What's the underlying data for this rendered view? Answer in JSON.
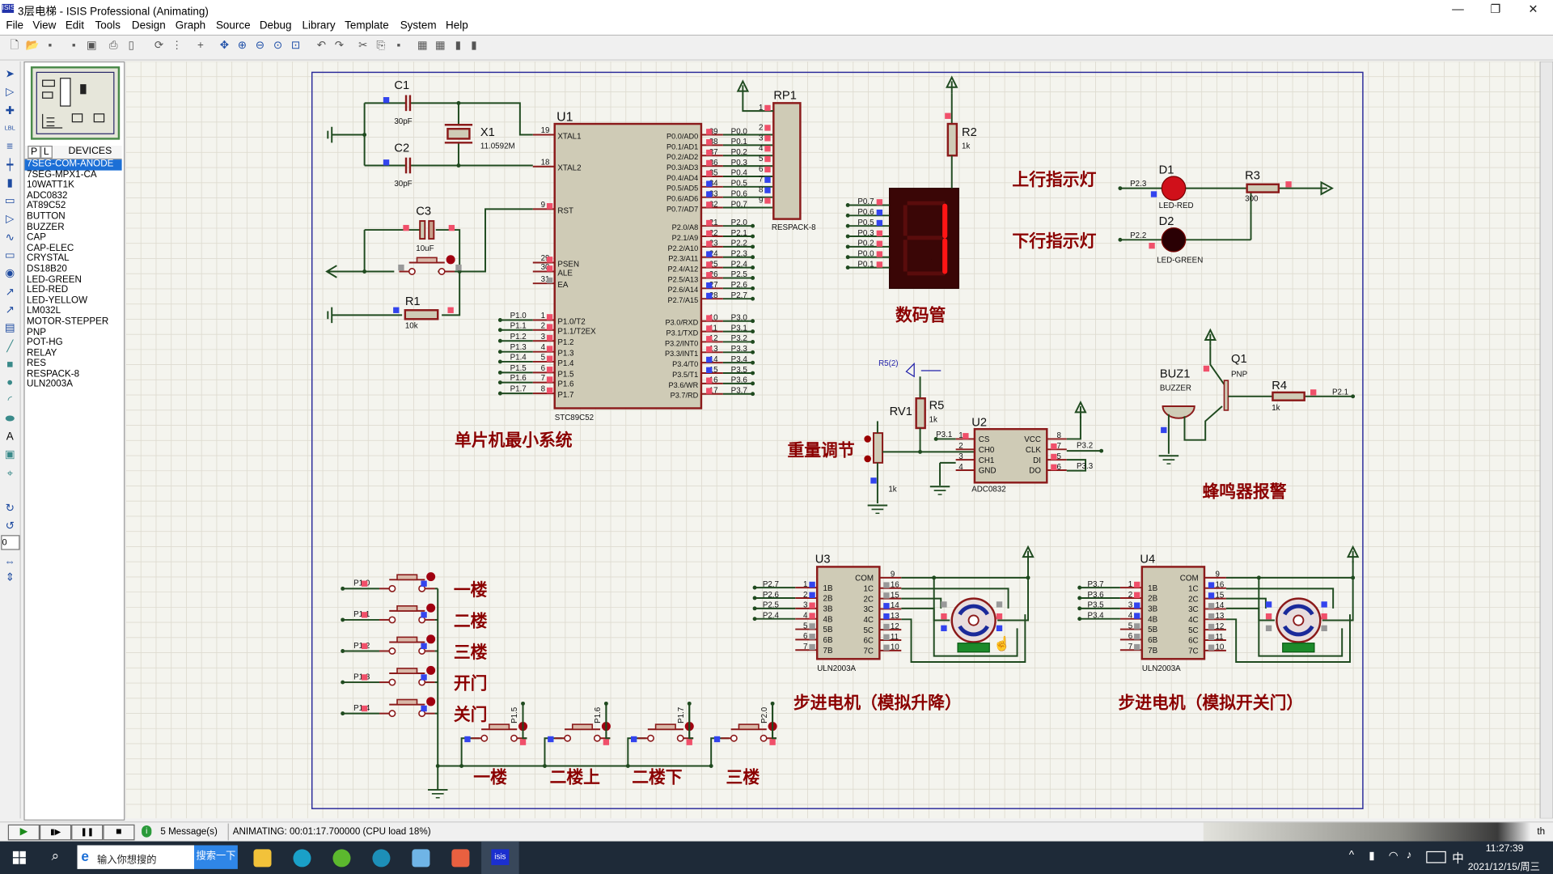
{
  "window": {
    "title": "3层电梯 - ISIS Professional (Animating)",
    "app_icon_text": "ISIS",
    "minimize": "—",
    "restore": "❐",
    "close": "✕"
  },
  "menu": [
    "File",
    "View",
    "Edit",
    "Tools",
    "Design",
    "Graph",
    "Source",
    "Debug",
    "Library",
    "Template",
    "System",
    "Help"
  ],
  "toolbar": {
    "icons": [
      "new-file-icon",
      "open-file-icon",
      "save-icon",
      "import-icon",
      "export-icon",
      "print-icon",
      "print-setup-icon",
      "refresh-icon",
      "grid-icon",
      "origin-icon",
      "pan-icon",
      "zoom-in-icon",
      "zoom-out-icon",
      "zoom-all-icon",
      "zoom-area-icon",
      "undo-icon",
      "redo-icon",
      "cut-icon",
      "copy-icon",
      "paste-icon",
      "block-copy-icon",
      "block-move-icon",
      "block-rotate-icon",
      "block-delete-icon"
    ]
  },
  "tools": {
    "icons": [
      "selection-mode-icon",
      "component-mode-icon",
      "junction-dot-icon",
      "wire-label-icon",
      "text-script-icon",
      "buses-icon",
      "subcircuit-icon",
      "terminals-icon",
      "device-pins-icon",
      "graph-icon",
      "tape-recorder-icon",
      "generator-icon",
      "voltage-probe-icon",
      "current-probe-icon",
      "virtual-instruments-icon",
      "line-icon",
      "box-icon",
      "circle-icon",
      "arc-icon",
      "path-icon",
      "text-icon",
      "symbol-icon",
      "marker-icon"
    ],
    "rotate_cw": "↻",
    "rotate_ccw": "↺",
    "rotation_value": "0",
    "mirror_h": "⇔",
    "mirror_v": "⇕"
  },
  "panel": {
    "tab_p": "P",
    "tab_l": "L",
    "header": "DEVICES",
    "devices": [
      "7SEG-COM-ANODE",
      "7SEG-MPX1-CA",
      "10WATT1K",
      "ADC0832",
      "AT89C52",
      "BUTTON",
      "BUZZER",
      "CAP",
      "CAP-ELEC",
      "CRYSTAL",
      "DS18B20",
      "LED-GREEN",
      "LED-RED",
      "LED-YELLOW",
      "LM032L",
      "MOTOR-STEPPER",
      "PNP",
      "POT-HG",
      "RELAY",
      "RES",
      "RESPACK-8",
      "ULN2003A"
    ],
    "selected_index": 0
  },
  "schematic": {
    "mcu": {
      "ref": "U1",
      "part": "STC89C52",
      "left_pins": [
        {
          "num": "19",
          "name": "XTAL1"
        },
        {
          "num": "18",
          "name": "XTAL2"
        },
        {
          "num": "9",
          "name": "RST"
        },
        {
          "num": "29",
          "name": "PSEN"
        },
        {
          "num": "30",
          "name": "ALE"
        },
        {
          "num": "31",
          "name": "EA"
        },
        {
          "num": "1",
          "name": "P1.0/T2",
          "net": "P1.0"
        },
        {
          "num": "2",
          "name": "P1.1/T2EX",
          "net": "P1.1"
        },
        {
          "num": "3",
          "name": "P1.2",
          "net": "P1.2"
        },
        {
          "num": "4",
          "name": "P1.3",
          "net": "P1.3"
        },
        {
          "num": "5",
          "name": "P1.4",
          "net": "P1.4"
        },
        {
          "num": "6",
          "name": "P1.5",
          "net": "P1.5"
        },
        {
          "num": "7",
          "name": "P1.6",
          "net": "P1.6"
        },
        {
          "num": "8",
          "name": "P1.7",
          "net": "P1.7"
        }
      ],
      "right_pins": [
        {
          "num": "39",
          "name": "P0.0/AD0",
          "net": "P0.0"
        },
        {
          "num": "38",
          "name": "P0.1/AD1",
          "net": "P0.1"
        },
        {
          "num": "37",
          "name": "P0.2/AD2",
          "net": "P0.2"
        },
        {
          "num": "36",
          "name": "P0.3/AD3",
          "net": "P0.3"
        },
        {
          "num": "35",
          "name": "P0.4/AD4",
          "net": "P0.4"
        },
        {
          "num": "34",
          "name": "P0.5/AD5",
          "net": "P0.5"
        },
        {
          "num": "33",
          "name": "P0.6/AD6",
          "net": "P0.6"
        },
        {
          "num": "32",
          "name": "P0.7/AD7",
          "net": "P0.7"
        },
        {
          "num": "21",
          "name": "P2.0/A8",
          "net": "P2.0"
        },
        {
          "num": "22",
          "name": "P2.1/A9",
          "net": "P2.1"
        },
        {
          "num": "23",
          "name": "P2.2/A10",
          "net": "P2.2"
        },
        {
          "num": "24",
          "name": "P2.3/A11",
          "net": "P2.3"
        },
        {
          "num": "25",
          "name": "P2.4/A12",
          "net": "P2.4"
        },
        {
          "num": "26",
          "name": "P2.5/A13",
          "net": "P2.5"
        },
        {
          "num": "27",
          "name": "P2.6/A14",
          "net": "P2.6"
        },
        {
          "num": "28",
          "name": "P2.7/A15",
          "net": "P2.7"
        },
        {
          "num": "10",
          "name": "P3.0/RXD",
          "net": "P3.0"
        },
        {
          "num": "11",
          "name": "P3.1/TXD",
          "net": "P3.1"
        },
        {
          "num": "12",
          "name": "P3.2/INT0",
          "net": "P3.2"
        },
        {
          "num": "13",
          "name": "P3.3/INT1",
          "net": "P3.3"
        },
        {
          "num": "14",
          "name": "P3.4/T0",
          "net": "P3.4"
        },
        {
          "num": "15",
          "name": "P3.5/T1",
          "net": "P3.5"
        },
        {
          "num": "16",
          "name": "P3.6/WR",
          "net": "P3.6"
        },
        {
          "num": "17",
          "name": "P3.7/RD",
          "net": "P3.7"
        }
      ]
    },
    "c1": {
      "ref": "C1",
      "value": "30pF"
    },
    "c2": {
      "ref": "C2",
      "value": "30pF"
    },
    "c3": {
      "ref": "C3",
      "value": "10uF"
    },
    "x1": {
      "ref": "X1",
      "value": "11.0592M"
    },
    "r1": {
      "ref": "R1",
      "value": "10k"
    },
    "rp1": {
      "ref": "RP1",
      "part": "RESPACK-8",
      "pins": [
        "1",
        "2",
        "3",
        "4",
        "5",
        "6",
        "7",
        "8",
        "9"
      ]
    },
    "r2": {
      "ref": "R2",
      "value": "1k"
    },
    "seg": {
      "label": "数码管",
      "pins": [
        "P0.7",
        "P0.6",
        "P0.5",
        "P0.3",
        "P0.2",
        "P0.0",
        "P0.1"
      ],
      "digit": "1"
    },
    "leds": {
      "up_label": "上行指示灯",
      "down_label": "下行指示灯",
      "d1_ref": "D1",
      "d1_part": "LED-RED",
      "d1_net": "P2.3",
      "d2_ref": "D2",
      "d2_part": "LED-GREEN",
      "d2_net": "P2.2",
      "r3_ref": "R3",
      "r3_value": "300"
    },
    "mcu_label": "单片机最小系统",
    "weight": {
      "label": "重量调节",
      "rv1": "RV1",
      "rv1_value": "1k",
      "r5": "R5",
      "r5_value": "1k",
      "probe": "R5(2)",
      "adc_ref": "U2",
      "adc_part": "ADC0832",
      "adc_left": [
        {
          "num": "1",
          "name": "CS",
          "net": "P3.1"
        },
        {
          "num": "2",
          "name": "CH0"
        },
        {
          "num": "3",
          "name": "CH1"
        },
        {
          "num": "4",
          "name": "GND"
        }
      ],
      "adc_right": [
        {
          "num": "8",
          "name": "VCC"
        },
        {
          "num": "7",
          "name": "CLK",
          "net": "P3.2"
        },
        {
          "num": "5",
          "name": "DI"
        },
        {
          "num": "6",
          "name": "DO",
          "net": "P3.3"
        }
      ]
    },
    "buzzer": {
      "label": "蜂鸣器报警",
      "buz_ref": "BUZ1",
      "buz_part": "BUZZER",
      "q_ref": "Q1",
      "q_part": "PNP",
      "r4_ref": "R4",
      "r4_value": "1k",
      "net": "P2.1"
    },
    "buttons_left": [
      {
        "net": "P1.0",
        "label": "一楼"
      },
      {
        "net": "P1.1",
        "label": "二楼"
      },
      {
        "net": "P1.2",
        "label": "三楼"
      },
      {
        "net": "P1.3",
        "label": "开门"
      },
      {
        "net": "P1.4",
        "label": "关门"
      }
    ],
    "buttons_bottom": [
      {
        "net": "P1.5",
        "label": "一楼"
      },
      {
        "net": "P1.6",
        "label": "二楼上"
      },
      {
        "net": "P1.7",
        "label": "二楼下"
      },
      {
        "net": "P2.0",
        "label": "三楼"
      }
    ],
    "u3": {
      "ref": "U3",
      "part": "ULN2003A",
      "inputs": [
        "P2.7",
        "P2.6",
        "P2.5",
        "P2.4"
      ],
      "label": "步进电机（模拟升降）"
    },
    "u4": {
      "ref": "U4",
      "part": "ULN2003A",
      "inputs": [
        "P3.7",
        "P3.6",
        "P3.5",
        "P3.4"
      ],
      "label": "步进电机（模拟开关门）"
    },
    "uln_left": [
      {
        "num": "1",
        "name": "1B"
      },
      {
        "num": "2",
        "name": "2B"
      },
      {
        "num": "3",
        "name": "3B"
      },
      {
        "num": "4",
        "name": "4B"
      },
      {
        "num": "5",
        "name": "5B"
      },
      {
        "num": "6",
        "name": "6B"
      },
      {
        "num": "7",
        "name": "7B"
      }
    ],
    "uln_right": [
      {
        "num": "9",
        "name": "COM"
      },
      {
        "num": "16",
        "name": "1C"
      },
      {
        "num": "15",
        "name": "2C"
      },
      {
        "num": "14",
        "name": "3C"
      },
      {
        "num": "13",
        "name": "4C"
      },
      {
        "num": "12",
        "name": "5C"
      },
      {
        "num": "11",
        "name": "6C"
      },
      {
        "num": "10",
        "name": "7C"
      }
    ]
  },
  "status": {
    "play": "▶",
    "step": "▮▶",
    "pause": "❚❚",
    "stop": "■",
    "messages": "5 Message(s)",
    "text": "ANIMATING: 00:01:17.700000 (CPU load 18%)",
    "right_tag": "th"
  },
  "taskbar": {
    "search_placeholder": "输入你想搜的",
    "search_button": "搜索一下",
    "time": "11:27:39",
    "date": "2021/12/15/周三",
    "ime": "中"
  },
  "colors": {
    "wire": "#1f4a1f",
    "component": "#8b1a1a",
    "body": "#cfcbb6",
    "label": "#8b0000",
    "pin_high": "#f0506a",
    "pin_low": "#3344ee",
    "grid": "#dedbd0",
    "canvas": "#f4f4ee",
    "selected": "#1c6fd6"
  }
}
